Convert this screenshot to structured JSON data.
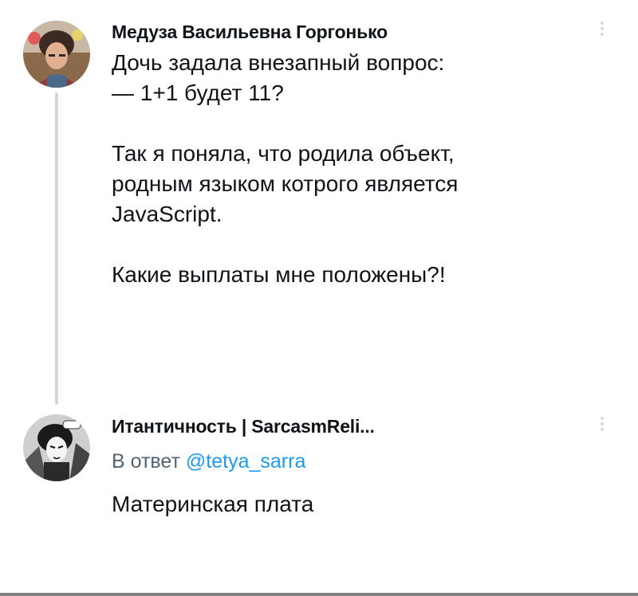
{
  "tweets": [
    {
      "author": "Медуза Васильевна Горгонько",
      "avatar_icon": "user-avatar-photo",
      "paragraphs": [
        "Дочь задала внезапный вопрос:\n— 1+1 будет 11?",
        "Так я поняла, что родила объект,\nродным языком котрого является\nJavaScript.",
        "Какие выплаты мне положены?!"
      ],
      "more_icon": "vertical-ellipsis-icon"
    },
    {
      "author": "Итантичность | SarcasmReli...",
      "avatar_icon": "comic-avatar-image",
      "reply_prefix": "В ответ",
      "reply_handle": "@tetya_sarra",
      "paragraphs": [
        "Материнская плата"
      ],
      "more_icon": "vertical-ellipsis-icon"
    }
  ],
  "colors": {
    "text": "#0f1419",
    "secondary": "#536471",
    "link": "#1d9bf0",
    "thread_line": "#cfd9de"
  }
}
